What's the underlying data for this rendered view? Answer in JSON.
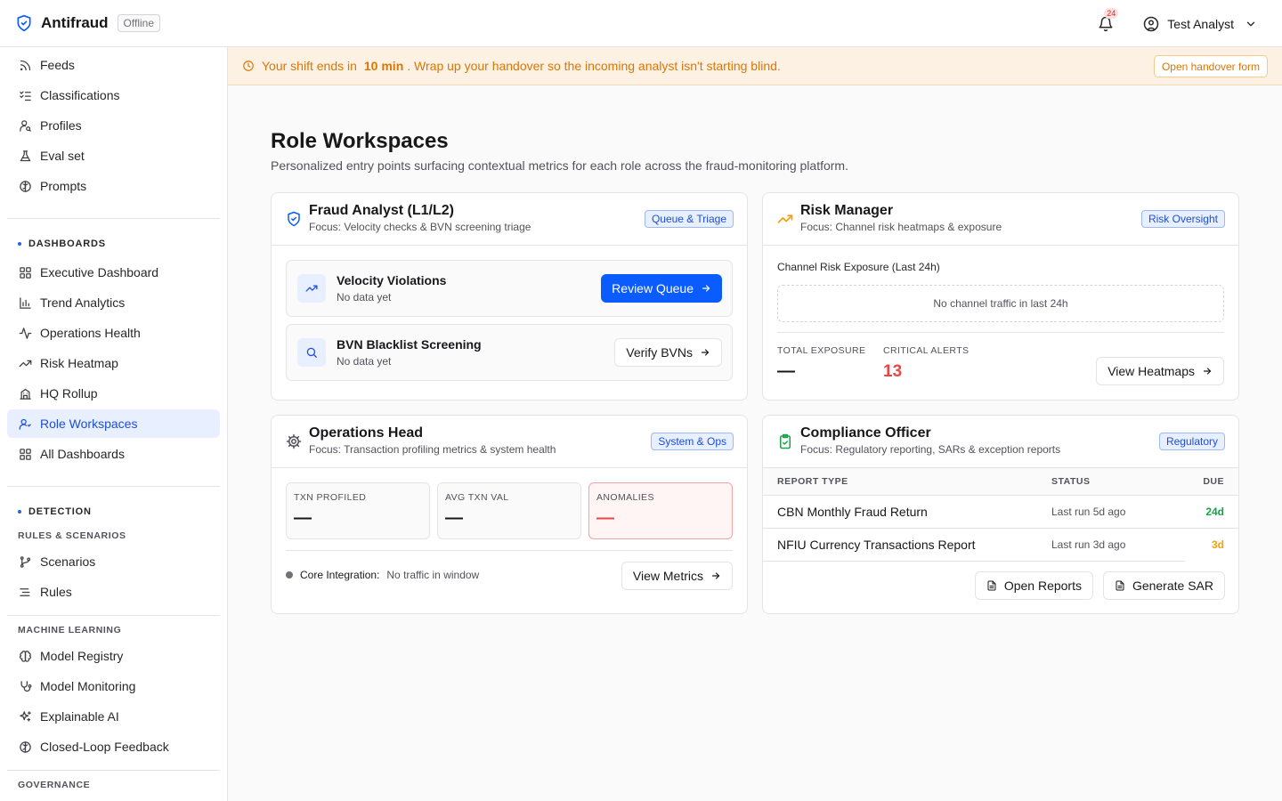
{
  "app": {
    "name": "Antifraud",
    "status_badge": "Offline"
  },
  "topbar": {
    "notifications_count": "24",
    "user_name": "Test Analyst"
  },
  "sidebar": {
    "items_top": [
      {
        "label": "Feeds",
        "icon": "rss-icon"
      },
      {
        "label": "Classifications",
        "icon": "list-checks-icon"
      },
      {
        "label": "Profiles",
        "icon": "user-search-icon"
      },
      {
        "label": "Eval set",
        "icon": "flask-icon"
      },
      {
        "label": "Prompts",
        "icon": "brain-icon"
      }
    ],
    "dashboards_label": "DASHBOARDS",
    "dashboards": [
      {
        "label": "Executive Dashboard",
        "icon": "layout-grid-icon"
      },
      {
        "label": "Trend Analytics",
        "icon": "bar-chart-icon"
      },
      {
        "label": "Operations Health",
        "icon": "activity-icon"
      },
      {
        "label": "Risk Heatmap",
        "icon": "trending-up-icon"
      },
      {
        "label": "HQ Rollup",
        "icon": "building-icon"
      },
      {
        "label": "Role Workspaces",
        "icon": "users-icon",
        "active": true
      },
      {
        "label": "All Dashboards",
        "icon": "layout-grid-icon"
      }
    ],
    "detection_label": "DETECTION",
    "rules_label": "RULES & SCENARIOS",
    "rules": [
      {
        "label": "Scenarios",
        "icon": "git-branch-icon"
      },
      {
        "label": "Rules",
        "icon": "list-filter-icon"
      }
    ],
    "ml_label": "MACHINE LEARNING",
    "ml": [
      {
        "label": "Model Registry",
        "icon": "brain-icon"
      },
      {
        "label": "Model Monitoring",
        "icon": "stethoscope-icon"
      },
      {
        "label": "Explainable AI",
        "icon": "sparkles-icon"
      },
      {
        "label": "Closed-Loop Feedback",
        "icon": "brain-icon"
      }
    ],
    "governance_label": "GOVERNANCE"
  },
  "banner": {
    "prefix": "Your shift ends in",
    "time": "10 min",
    "suffix": ". Wrap up your handover so the incoming analyst isn't starting blind.",
    "button": "Open handover form"
  },
  "page": {
    "title": "Role Workspaces",
    "subtitle": "Personalized entry points surfacing contextual metrics for each role across the fraud-monitoring platform."
  },
  "fraud_analyst": {
    "title": "Fraud Analyst (L1/L2)",
    "focus": "Focus: Velocity checks & BVN screening triage",
    "tag": "Queue & Triage",
    "tasks": [
      {
        "title": "Velocity Violations",
        "sub": "No data yet",
        "button": "Review Queue"
      },
      {
        "title": "BVN Blacklist Screening",
        "sub": "No data yet",
        "button": "Verify BVNs"
      }
    ]
  },
  "risk_manager": {
    "title": "Risk Manager",
    "focus": "Focus: Channel risk heatmaps & exposure",
    "tag": "Risk Oversight",
    "section_label": "Channel Risk Exposure (Last 24h)",
    "empty_text": "No channel traffic in last 24h",
    "total_label": "TOTAL EXPOSURE",
    "total_value": "—",
    "critical_label": "CRITICAL ALERTS",
    "critical_value": "13",
    "button": "View Heatmaps"
  },
  "operations_head": {
    "title": "Operations Head",
    "focus": "Focus: Transaction profiling metrics & system health",
    "tag": "System & Ops",
    "stats": [
      {
        "label": "TXN PROFILED",
        "value": "—"
      },
      {
        "label": "AVG TXN VAL",
        "value": "—"
      },
      {
        "label": "ANOMALIES",
        "value": "—"
      }
    ],
    "integration_label": "Core Integration:",
    "integration_value": "No traffic in window",
    "button": "View Metrics"
  },
  "compliance": {
    "title": "Compliance Officer",
    "focus": "Focus: Regulatory reporting, SARs & exception reports",
    "tag": "Regulatory",
    "columns": [
      "REPORT TYPE",
      "STATUS",
      "DUE"
    ],
    "rows": [
      {
        "type": "CBN Monthly Fraud Return",
        "status": "Last run 5d ago",
        "due": "24d"
      },
      {
        "type": "NFIU Currency Transactions Report",
        "status": "Last run 3d ago",
        "due": "3d"
      }
    ],
    "buttons": [
      "Open Reports",
      "Generate SAR"
    ]
  },
  "colors": {
    "accent": "#0b5cff",
    "warning": "#d97706",
    "danger": "#ef4444",
    "success": "#16a34a",
    "due_warn": "#f59e0b"
  }
}
